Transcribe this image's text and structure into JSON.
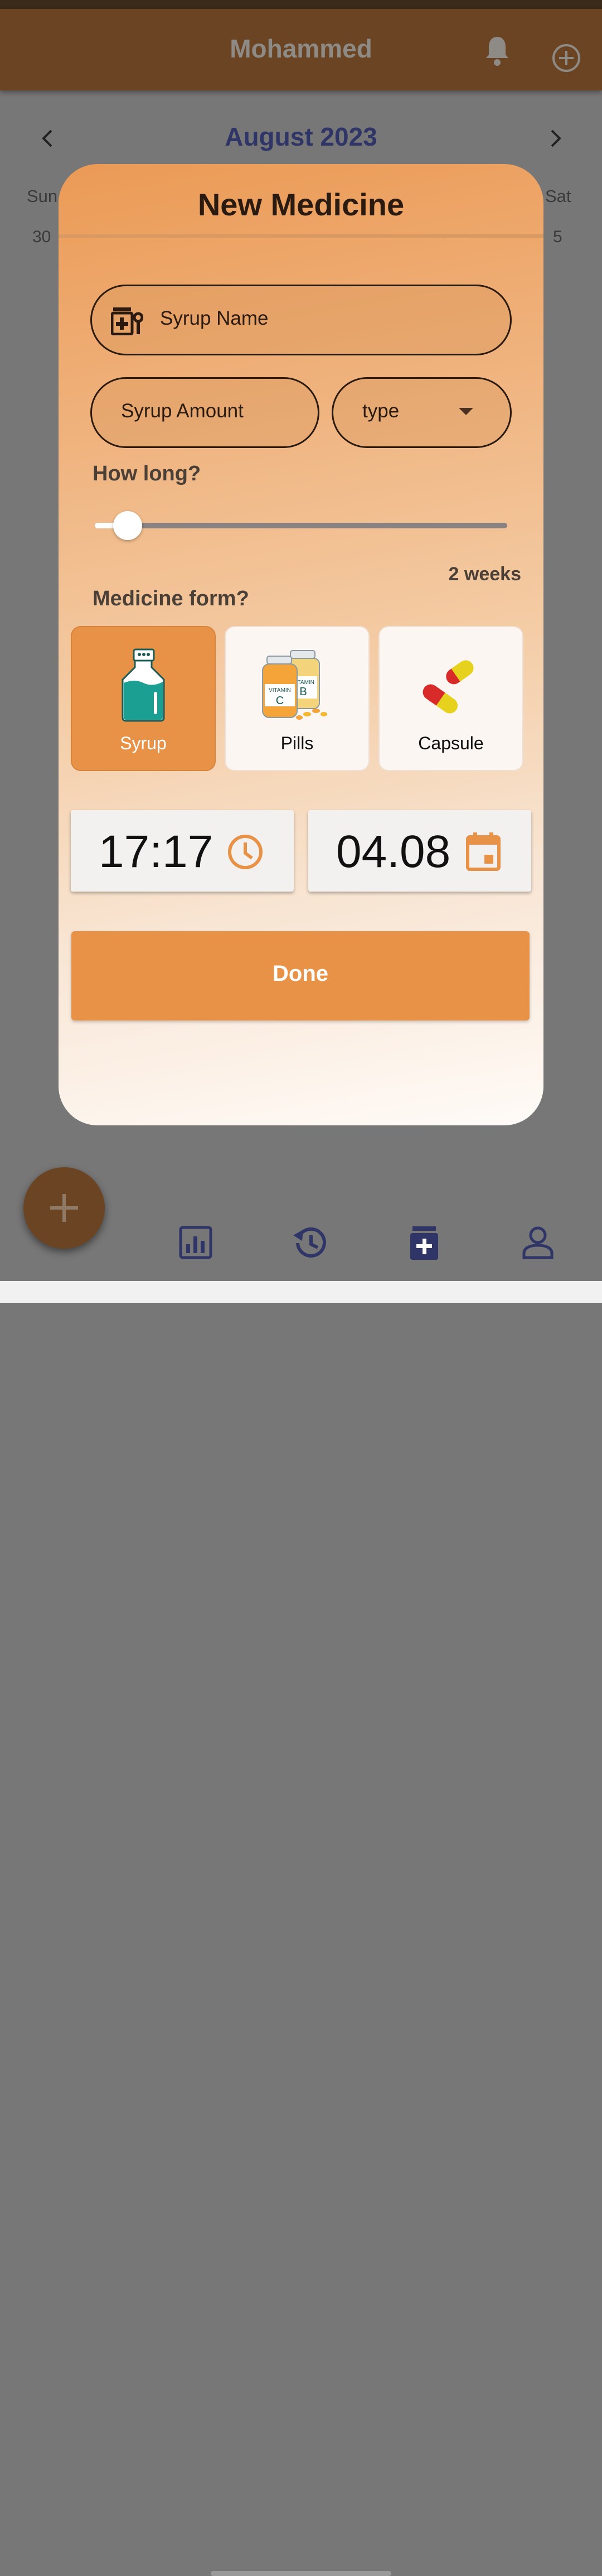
{
  "app": {
    "title": "Mohammed"
  },
  "calendar": {
    "month": "August 2023",
    "weekday_first": "Sun",
    "weekday_last": "Sat",
    "day_first": "30",
    "day_last": "5"
  },
  "modal": {
    "title": "New Medicine",
    "name_placeholder": "Syrup Name",
    "amount_placeholder": "Syrup Amount",
    "type_placeholder": "type",
    "duration_label": "How long?",
    "duration_value": "2 weeks",
    "duration_fraction": 0.08,
    "form_label": "Medicine form?",
    "forms": [
      {
        "label": "Syrup",
        "selected": true
      },
      {
        "label": "Pills",
        "selected": false
      },
      {
        "label": "Capsule",
        "selected": false
      }
    ],
    "time": "17:17",
    "date": "04.08",
    "done_label": "Done"
  },
  "colors": {
    "accent": "#e89247",
    "app_bar": "#6b4523",
    "nav_icon": "#2f3566"
  }
}
